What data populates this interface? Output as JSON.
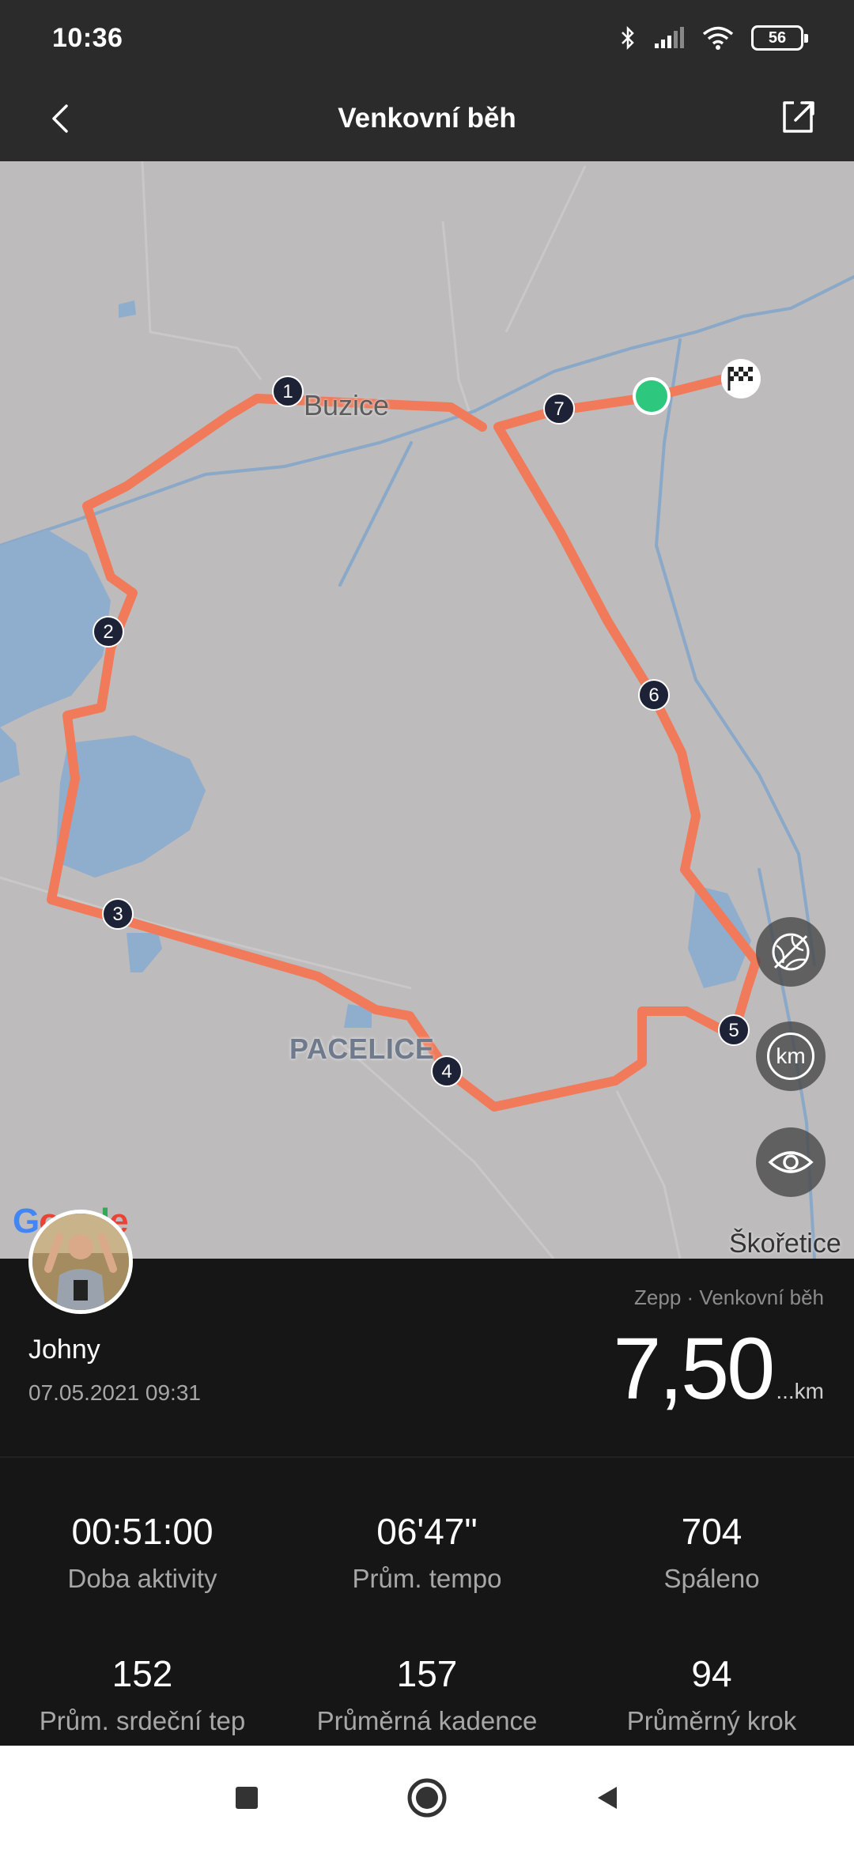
{
  "status_bar": {
    "time": "10:36",
    "battery_level": "56",
    "icons": [
      "bluetooth-icon",
      "signal-icon",
      "wifi-icon",
      "battery-icon"
    ]
  },
  "header": {
    "title": "Venkovní běh",
    "back_icon": "chevron-left-icon",
    "share_icon": "share-external-icon"
  },
  "map": {
    "labels": {
      "buzice": "Buzice",
      "pacelice": "PACELICE",
      "skoretice": "Škořetice"
    },
    "km_markers": [
      "1",
      "2",
      "3",
      "4",
      "5",
      "6",
      "7"
    ],
    "google_logo": "Google",
    "buttons": {
      "satellite": "satellite-off-icon",
      "km": "km",
      "visibility": "eye-icon"
    },
    "colors": {
      "route": "#f07a5a",
      "start": "#2dc77e",
      "water": "#89a9c8",
      "land": "#bdbbbb"
    }
  },
  "activity": {
    "user_name": "Johny",
    "date": "07.05.2021 09:31",
    "source": "Zepp · Venkovní běh",
    "distance": "7,50",
    "distance_unit": "...km"
  },
  "stats": [
    {
      "value": "00:51:00",
      "label": "Doba aktivity"
    },
    {
      "value": "06'47\"",
      "label": "Prům. tempo"
    },
    {
      "value": "704",
      "label": "Spáleno"
    },
    {
      "value": "152",
      "label": "Prům. srdeční tep"
    },
    {
      "value": "157",
      "label": "Průměrná kadence"
    },
    {
      "value": "94",
      "label": "Průměrný krok"
    }
  ],
  "nav_bar": {
    "icons": [
      "recents-square-icon",
      "home-circle-icon",
      "back-triangle-icon"
    ]
  }
}
